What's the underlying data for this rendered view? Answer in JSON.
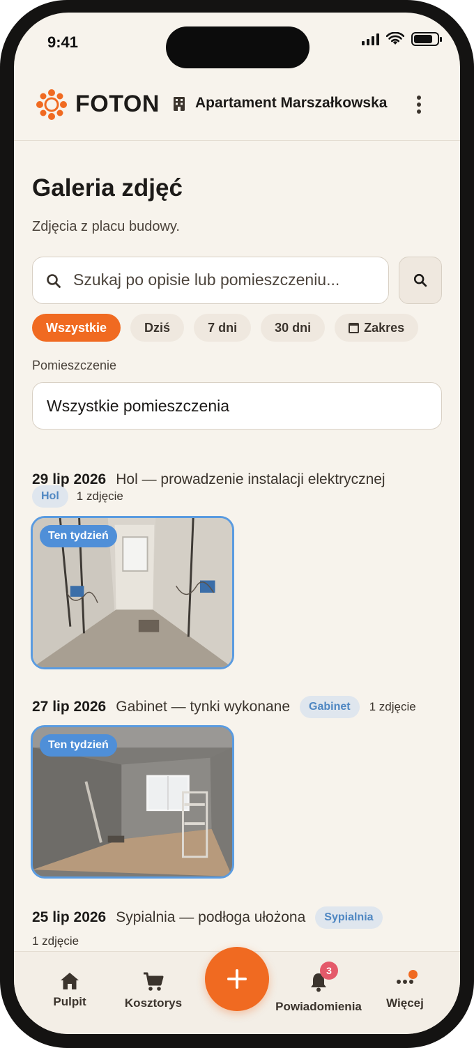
{
  "status_bar": {
    "time": "9:41"
  },
  "header": {
    "logo_text": "FOTON",
    "project_name": "Apartament Marszałkowska",
    "colors": {
      "accent": "#f06a21",
      "badge_blue": "#4f8fd8"
    }
  },
  "page": {
    "title": "Galeria zdjęć",
    "subtitle": "Zdjęcia z placu budowy."
  },
  "search": {
    "placeholder": "Szukaj po opisie lub pomieszczeniu..."
  },
  "date_filters": [
    {
      "label": "Wszystkie",
      "active": true
    },
    {
      "label": "Dziś",
      "active": false
    },
    {
      "label": "7 dni",
      "active": false
    },
    {
      "label": "30 dni",
      "active": false
    },
    {
      "label": "Zakres",
      "active": false,
      "icon": "calendar-icon"
    }
  ],
  "room_filter": {
    "label": "Pomieszczenie",
    "value": "Wszystkie pomieszczenia"
  },
  "entries": [
    {
      "date": "29 lip 2026",
      "title": "Hol — prowadzenie instalacji elektrycznej",
      "room": "Hol",
      "count": "1 zdjęcie",
      "badge": "Ten tydzień"
    },
    {
      "date": "27 lip 2026",
      "title": "Gabinet — tynki wykonane",
      "room": "Gabinet",
      "count": "1 zdjęcie",
      "badge": "Ten tydzień"
    },
    {
      "date": "25 lip 2026",
      "title": "Sypialnia — podłoga ułożona",
      "room": "Sypialnia",
      "count": "1 zdjęcie"
    }
  ],
  "bottom_nav": {
    "items": [
      {
        "label": "Pulpit",
        "icon": "home-icon"
      },
      {
        "label": "Kosztorys",
        "icon": "cart-icon"
      },
      {
        "label": "Powiadomienia",
        "icon": "bell-icon",
        "badge": "3"
      },
      {
        "label": "Więcej",
        "icon": "more-icon"
      }
    ],
    "fab_icon": "plus-icon"
  }
}
